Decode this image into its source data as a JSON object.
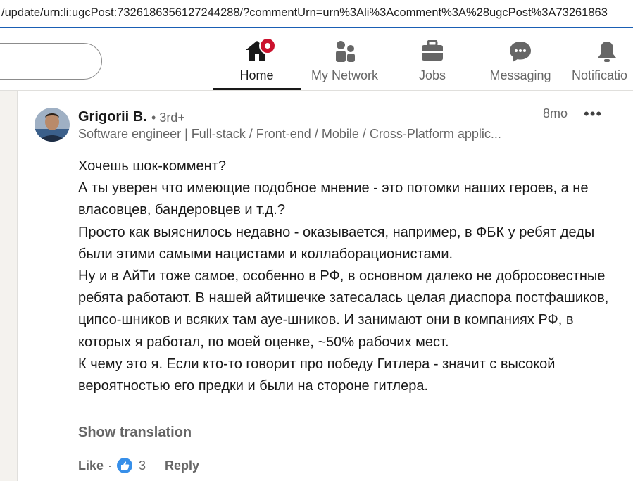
{
  "browser": {
    "url": "/update/urn:li:ugcPost:7326186356127244288/?commentUrn=urn%3Ali%3Acomment%3A%28ugcPost%3A73261863"
  },
  "nav": {
    "items": [
      {
        "label": "Home",
        "icon": "home-icon"
      },
      {
        "label": "My Network",
        "icon": "network-icon"
      },
      {
        "label": "Jobs",
        "icon": "briefcase-icon"
      },
      {
        "label": "Messaging",
        "icon": "messaging-icon"
      },
      {
        "label": "Notificatio",
        "icon": "bell-icon"
      }
    ],
    "active": "Home"
  },
  "comment": {
    "author": "Grigorii B.",
    "degree": "• 3rd+",
    "headline": "Software engineer | Full-stack / Front-end / Mobile / Cross-Platform applic...",
    "time": "8mo",
    "more": "•••",
    "paragraphs": [
      "Хочешь шок-коммент?",
      "А ты уверен что имеющие подобное мнение - это потомки наших героев, а не власовцев, бандеровцев и т.д.?",
      "Просто как выяснилось недавно - оказывается, например, в ФБК у ребят деды были этими самыми нацистами и коллаборационистами.",
      "Ну и в АйТи тоже самое, особенно в РФ, в основном далеко не добросовестные ребята работают. В нашей айтишечке затесалась целая диаспора постфашиков, ципсо-шников и всяких там ауе-шников. И занимают они в компаниях РФ, в которых я работал, по моей оценке, ~50% рабочих мест.",
      "К чему это я. Если кто-то говорит про победу Гитлера - значит с высокой вероятностью его предки и были на стороне гитлера."
    ],
    "show_translation": "Show translation",
    "like_label": "Like",
    "dot": "·",
    "reaction_count": "3",
    "reply_label": "Reply"
  },
  "colors": {
    "badge": "#cb112d",
    "like_reaction": "#378fe9",
    "url_focus": "#1a5fb4"
  }
}
